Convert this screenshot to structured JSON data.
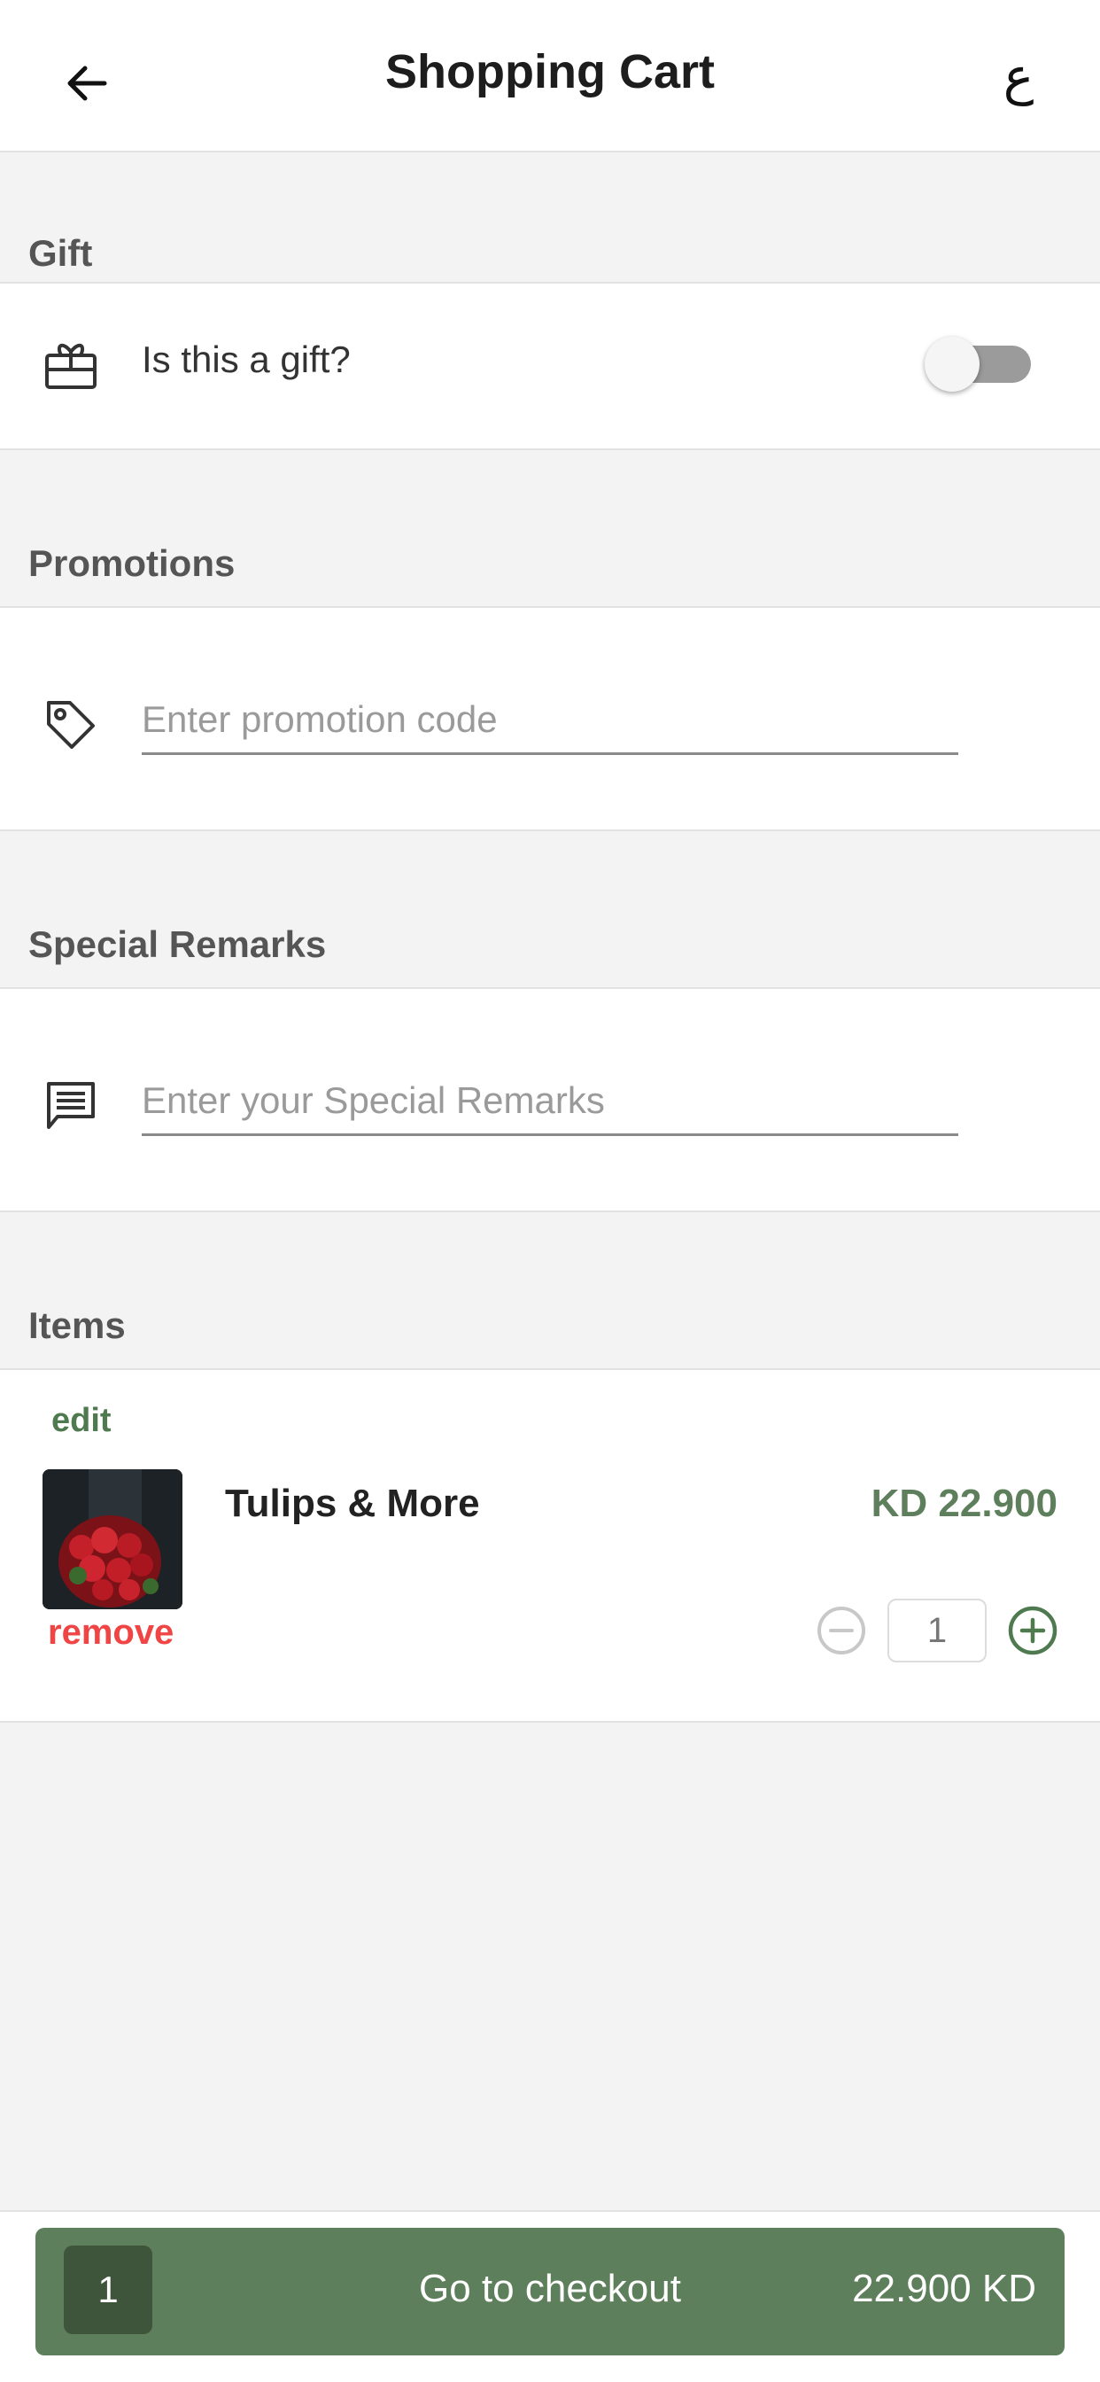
{
  "header": {
    "title": "Shopping Cart",
    "language_toggle": "ع"
  },
  "gift": {
    "section_label": "Gift",
    "question": "Is this a gift?",
    "toggle_on": false
  },
  "promotions": {
    "section_label": "Promotions",
    "placeholder": "Enter promotion code",
    "value": ""
  },
  "remarks": {
    "section_label": "Special Remarks",
    "placeholder": "Enter your Special Remarks",
    "value": ""
  },
  "items": {
    "section_label": "Items",
    "list": [
      {
        "edit_label": "edit",
        "name": "Tulips & More",
        "price": "KD 22.900",
        "remove_label": "remove",
        "quantity": "1"
      }
    ]
  },
  "checkout": {
    "count": "1",
    "label": "Go to checkout",
    "total": "22.900 KD"
  },
  "colors": {
    "accent": "#5e7f5b",
    "accent_dark": "#3e553c",
    "danger": "#f04545",
    "background": "#f3f3f3"
  },
  "icons": {
    "back": "arrow-left-icon",
    "gift": "gift-card-icon",
    "promotion": "tag-icon",
    "remarks": "message-icon",
    "decrease": "minus-circle-icon",
    "increase": "plus-circle-icon"
  }
}
